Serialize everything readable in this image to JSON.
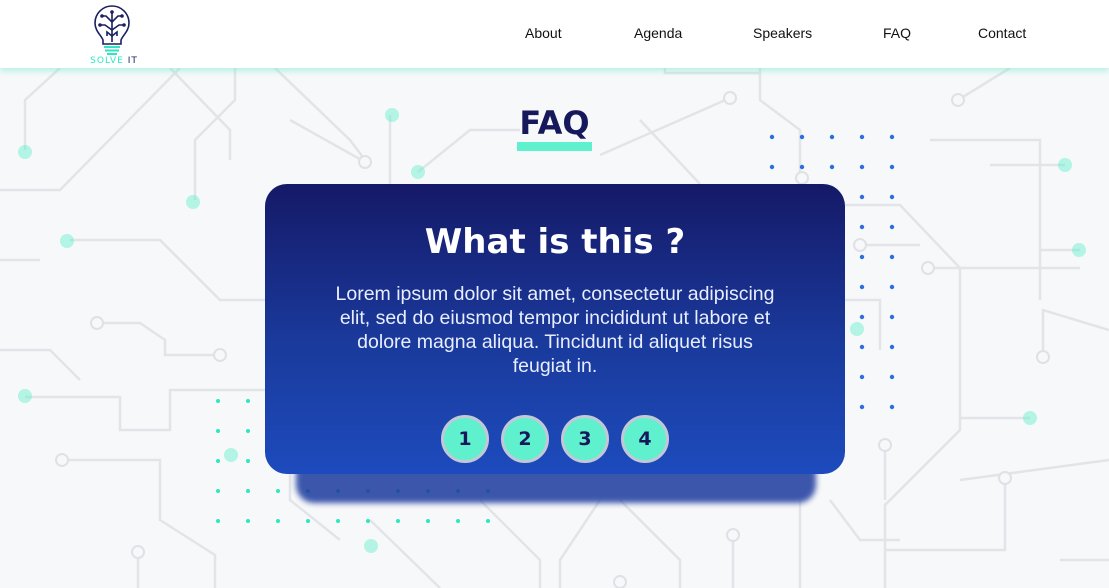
{
  "brand": {
    "logo_text_1": "SOLVE",
    "logo_text_2": "IT",
    "accent_color": "#5ff0cd",
    "navy_color": "#15185a"
  },
  "nav": {
    "items": [
      {
        "label": "About"
      },
      {
        "label": "Agenda"
      },
      {
        "label": "Speakers"
      },
      {
        "label": "FAQ"
      },
      {
        "label": "Contact"
      }
    ]
  },
  "faq": {
    "section_title": "FAQ",
    "question": "What is this ?",
    "answer": "Lorem ipsum dolor sit amet, consectetur adipiscing elit, sed do eiusmod tempor incididunt ut labore et dolore magna aliqua. Tincidunt id aliquet risus feugiat in.",
    "pages": [
      "1",
      "2",
      "3",
      "4"
    ]
  },
  "background": {
    "decoration": "circuit-board-pattern",
    "line_color": "#e3e5e9",
    "dot_colors": [
      "#5ff0cd",
      "#2a6ee0"
    ]
  }
}
